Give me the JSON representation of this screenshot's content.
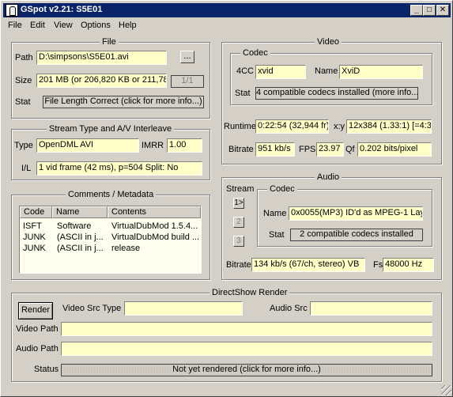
{
  "window": {
    "title": "GSpot v2.21: S5E01"
  },
  "titlebar_buttons": {
    "minimize": "_",
    "maximize": "□",
    "close": "✕"
  },
  "menu": [
    "File",
    "Edit",
    "View",
    "Options",
    "Help"
  ],
  "file": {
    "legend": "File",
    "path_label": "Path",
    "path_value": "D:\\simpsons\\S5E01.avi",
    "browse_label": "...",
    "size_label": "Size",
    "size_value": "201 MB (or 206,820 KB or 211,78",
    "part_label": "1/1",
    "stat_label": "Stat",
    "stat_value": "File Length Correct (click for more info...)"
  },
  "stream_type": {
    "legend": "Stream Type and A/V Interleave",
    "type_label": "Type",
    "type_value": "OpenDML AVI",
    "imrr_label": "IMRR",
    "imrr_value": "1.00",
    "il_label": "I/L",
    "il_value": "1 vid frame (42 ms), p=504  Split: No"
  },
  "comments": {
    "legend": "Comments / Metadata",
    "columns": [
      "Code",
      "Name",
      "Contents"
    ],
    "rows": [
      [
        "ISFT",
        "Software",
        "VirtualDubMod 1.5.4..."
      ],
      [
        "JUNK",
        "(ASCII in j...",
        "VirtualDubMod build ..."
      ],
      [
        "JUNK",
        "(ASCII in j...",
        "release"
      ]
    ]
  },
  "video": {
    "legend": "Video",
    "codec_legend": "Codec",
    "fourcc_label": "4CC",
    "fourcc_value": "xvid",
    "name_label": "Name",
    "name_value": "XviD",
    "stat_label": "Stat",
    "stat_value": "4 compatible codecs installed (more info...)",
    "runtime_label": "Runtime",
    "runtime_value": "0:22:54 (32,944 fr)",
    "xy_label": "x:y",
    "xy_value": "12x384 (1.33:1) [=4:3]",
    "bitrate_label": "Bitrate",
    "bitrate_value": "951 kb/s",
    "fps_label": "FPS",
    "fps_value": "23.97",
    "qf_label": "Qf",
    "qf_value": "0.202 bits/pixel"
  },
  "audio": {
    "legend": "Audio",
    "stream_label": "Stream",
    "stream_buttons": [
      "1>",
      "2",
      "3"
    ],
    "codec_legend": "Codec",
    "name_label": "Name",
    "name_value": "0x0055(MP3) ID'd as MPEG-1 Lay",
    "stat_label": "Stat",
    "stat_value": "2 compatible codecs installed",
    "bitrate_label": "Bitrate",
    "bitrate_value": "134 kb/s (67/ch, stereo) VB",
    "fs_label": "Fs",
    "fs_value": "48000 Hz"
  },
  "directshow": {
    "legend": "DirectShow Render",
    "render_label": "Render",
    "video_src_type_label": "Video Src Type",
    "video_src_type_value": "",
    "audio_src_label": "Audio Src",
    "audio_src_value": "",
    "video_path_label": "Video Path",
    "video_path_value": "",
    "audio_path_label": "Audio Path",
    "audio_path_value": "",
    "status_label": "Status",
    "status_value": "Not yet rendered (click for more info...)"
  }
}
